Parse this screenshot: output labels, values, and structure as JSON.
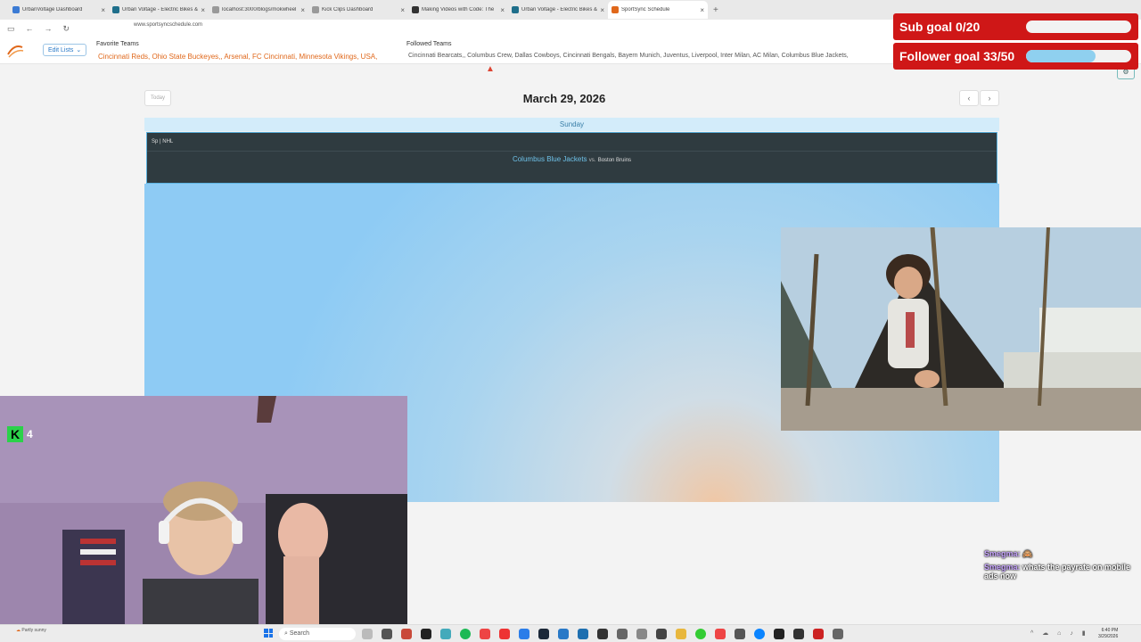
{
  "browser": {
    "tabs": [
      {
        "title": "UrbanVoltage Dashboard",
        "fav": "#3b7bd4"
      },
      {
        "title": "Urban Voltage - Electric Bikes &",
        "fav": "#1f6f8b"
      },
      {
        "title": "localhost:3000/blogs/mokwheel",
        "fav": "#999999"
      },
      {
        "title": "Kick Clips Dashboard",
        "fav": "#999999"
      },
      {
        "title": "Making Videos with Code: The",
        "fav": "#333333"
      },
      {
        "title": "Urban Voltage - Electric Bikes &",
        "fav": "#1f6f8b"
      },
      {
        "title": "SportSync Schedule",
        "fav": "#e0681b"
      }
    ],
    "url": "www.sportsyncschedule.com"
  },
  "app": {
    "edit_lists": "Edit Lists",
    "favorite_title": "Favorite Teams",
    "favorite_teams": "Cincinnati Reds, Ohio State Buckeyes,, Arsenal, FC Cincinnati, Minnesota Vikings, USA,",
    "followed_title": "Followed Teams",
    "followed_teams": "Cincinnati Bearcats,, Columbus Crew, Dallas Cowboys, Cincinnati Bengals, Bayern Munich, Juventus, Liverpool, Inter Milan, AC Milan, Columbus Blue Jackets,",
    "today": "Today",
    "date": "March 29, 2026",
    "day": "Sunday",
    "game": {
      "league": "Sp | NHL",
      "home": "Columbus Blue Jackets",
      "vs": "vs.",
      "away": "Boston Bruins"
    }
  },
  "overlay": {
    "sub_goal": "Sub goal 0/20",
    "sub_progress": 0,
    "follower_goal": "Follower goal 33/50",
    "follower_progress": 0.66,
    "kick_count": "4",
    "chat": [
      {
        "user": "Smegma:",
        "msg": "🙈"
      },
      {
        "user": "Smegma:",
        "msg": "whats the payrate on mobile ads now"
      }
    ]
  },
  "taskbar": {
    "weather": "Partly sunny",
    "search": "Search",
    "time": "6:40 PM",
    "date": "3/29/2026"
  }
}
